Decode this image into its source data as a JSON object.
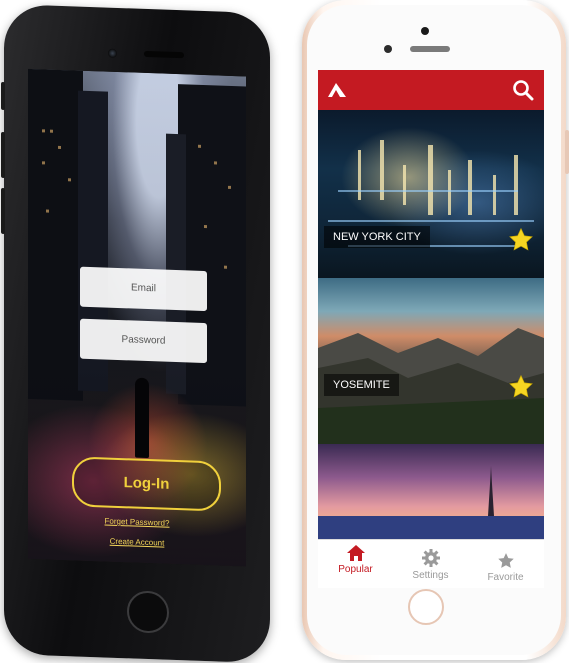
{
  "login_screen": {
    "email_placeholder": "Email",
    "password_placeholder": "Password",
    "login_button": "Log-In",
    "forgot_password": "Forget Password?",
    "create_account": "Create Account",
    "accent_color": "#f0d03c"
  },
  "app_screen": {
    "brand_color": "#c41a22",
    "header": {
      "logo_icon": "arrow-logo-icon",
      "search_icon": "search-icon"
    },
    "cards": [
      {
        "title": "NEW YORK CITY",
        "favorite": true
      },
      {
        "title": "YOSEMITE",
        "favorite": true
      }
    ],
    "tabs": [
      {
        "label": "Popular",
        "icon": "home-icon",
        "active": true
      },
      {
        "label": "Settings",
        "icon": "gear-icon",
        "active": false
      },
      {
        "label": "Favorite",
        "icon": "star-icon",
        "active": false
      }
    ]
  }
}
